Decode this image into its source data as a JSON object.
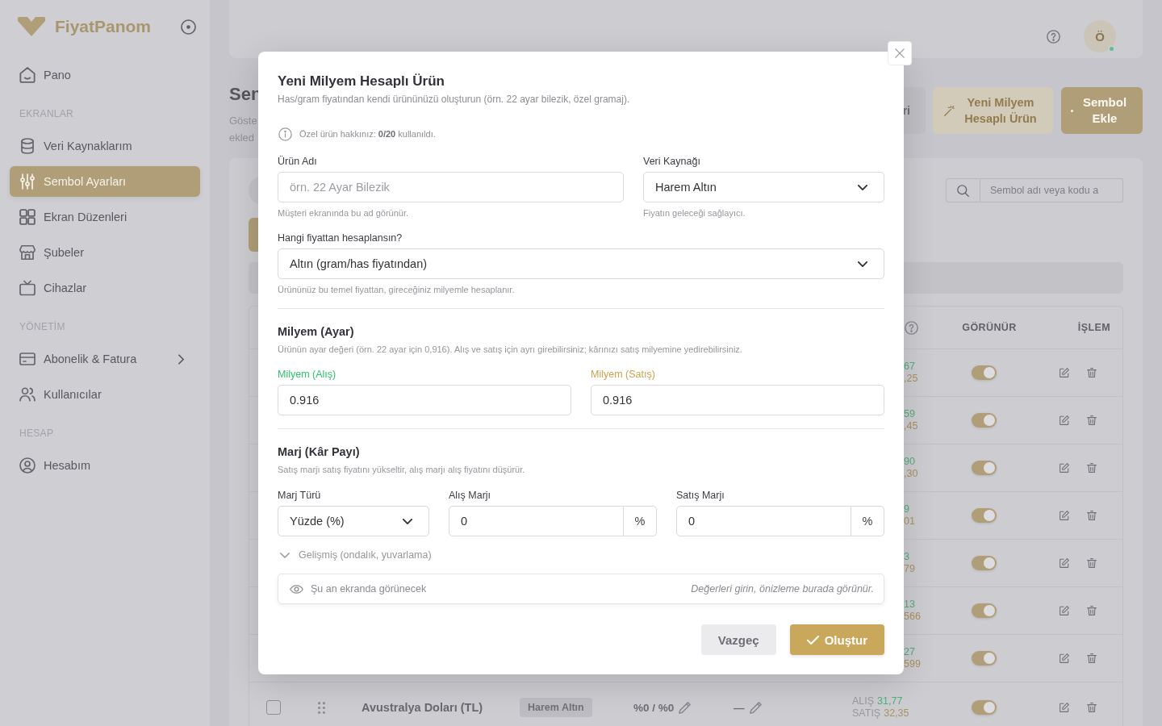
{
  "sidebar": {
    "brand": "FiyatPanom",
    "sections": [
      {
        "items": [
          {
            "label": "Pano",
            "kind": "link",
            "selected": false
          }
        ]
      },
      {
        "title": "EKRANLAR",
        "items": [
          {
            "label": "Veri Kaynaklarım",
            "kind": "link",
            "selected": false
          },
          {
            "label": "Sembol Ayarları",
            "kind": "link",
            "selected": true
          },
          {
            "label": "Ekran Düzenleri",
            "kind": "link",
            "selected": false
          },
          {
            "label": "Şubeler",
            "kind": "link",
            "selected": false
          },
          {
            "label": "Cihazlar",
            "kind": "link",
            "selected": false
          }
        ]
      },
      {
        "title": "YÖNETİM",
        "items": [
          {
            "label": "Abonelik & Fatura",
            "kind": "group",
            "selected": false
          },
          {
            "label": "Kullanıcılar",
            "kind": "link",
            "selected": false
          }
        ]
      },
      {
        "title": "HESAP",
        "items": [
          {
            "label": "Hesabım",
            "kind": "link",
            "selected": false
          }
        ]
      }
    ]
  },
  "header": {
    "avatar": "Ö",
    "online": true
  },
  "page": {
    "title": "Sen",
    "description": [
      "Göste",
      "ekled"
    ],
    "actions": [
      {
        "label": "ri",
        "kind": "secondary"
      },
      {
        "label": "Yeni Milyem Hesaplı Ürün",
        "kind": "soft"
      },
      {
        "label": "Sembol Ekle",
        "kind": "primary"
      }
    ]
  },
  "symbols": {
    "search": {
      "placeholder": "Sembol adı veya kodu a"
    },
    "columns": [
      "GÖRÜNÜR",
      "İŞLEM"
    ],
    "rows": [
      {
        "kind": "clipped",
        "buy": "67",
        "sell": ",25",
        "visible": true
      },
      {
        "kind": "clipped",
        "buy": "59",
        "sell": ",45",
        "visible": true
      },
      {
        "kind": "clipped",
        "buy": "90",
        "sell": ",30",
        "visible": true
      },
      {
        "kind": "clipped",
        "buy": "9",
        "sell": "01",
        "visible": true
      },
      {
        "kind": "clipped",
        "buy": "3",
        "sell": "79",
        "visible": true
      },
      {
        "kind": "clipped",
        "buy": "13",
        "sell": "566",
        "visible": true
      },
      {
        "kind": "clipped",
        "buy": "27",
        "sell": "599",
        "visible": true
      },
      {
        "kind": "full",
        "checked": false,
        "name": "Avustralya Doları (TL)",
        "source": "Harem Altın",
        "margin": "%0 / %0",
        "milyem": "—",
        "buy_label": "ALIŞ",
        "buy": "31,77",
        "sell_label": "SATIŞ",
        "sell": "32,35",
        "visible": true
      }
    ]
  },
  "modal": {
    "title": "Yeni Milyem Hesaplı Ürün",
    "subtitle": "Has/gram fiyatından kendi ürününüzü oluşturun (örn. 22 ayar bilezik, özel gramaj).",
    "quota_note": "Özel ürün hakkınız: **0/20** kullanıldı.",
    "product_name": {
      "label": "Ürün Adı",
      "placeholder": "örn. 22 Ayar Bilezik",
      "help": "Müşteri ekranında bu ad görünür."
    },
    "data_source": {
      "label": "Veri Kaynağı",
      "value": "Harem Altın",
      "help": "Fiyatın geleceği sağlayıcı."
    },
    "base_price": {
      "label": "Hangi fiyattan hesaplansın?",
      "value": "Altın (gram/has fiyatından)",
      "help": "Ürününüz bu temel fiyattan, gireceğiniz milyemle hesaplanır."
    },
    "milyem": {
      "title": "Milyem (Ayar)",
      "description": "Ürünün ayar değeri (örn. 22 ayar için 0,916). Alış ve satış için ayrı girebilirsiniz; kârınızı satış milyemine yedirebilirsiniz.",
      "fields": [
        {
          "label": "Milyem (Alış)",
          "value": "0.916",
          "color": "#2fc26b"
        },
        {
          "label": "Milyem (Satış)",
          "value": "0.916",
          "color": "#c9a34e"
        }
      ]
    },
    "margin": {
      "title": "Marj (Kâr Payı)",
      "description": "Satış marjı satış fiyatını yükseltir, alış marjı alış fiyatını düşürür.",
      "type": {
        "label": "Marj Türü",
        "value": "Yüzde (%)"
      },
      "fields": [
        {
          "label": "Alış Marjı",
          "value": "0",
          "unit": "%"
        },
        {
          "label": "Satış Marjı",
          "value": "0",
          "unit": "%"
        }
      ]
    },
    "advanced": {
      "label": "Gelişmiş (ondalık, yuvarlama)",
      "expanded": false
    },
    "preview": {
      "label": "Şu an ekranda görünecek",
      "hint": "Değerleri girin, önizleme burada görünür."
    },
    "buttons": [
      {
        "label": "Vazgeç",
        "kind": "secondary"
      },
      {
        "label": "Oluştur",
        "kind": "primary"
      }
    ]
  }
}
